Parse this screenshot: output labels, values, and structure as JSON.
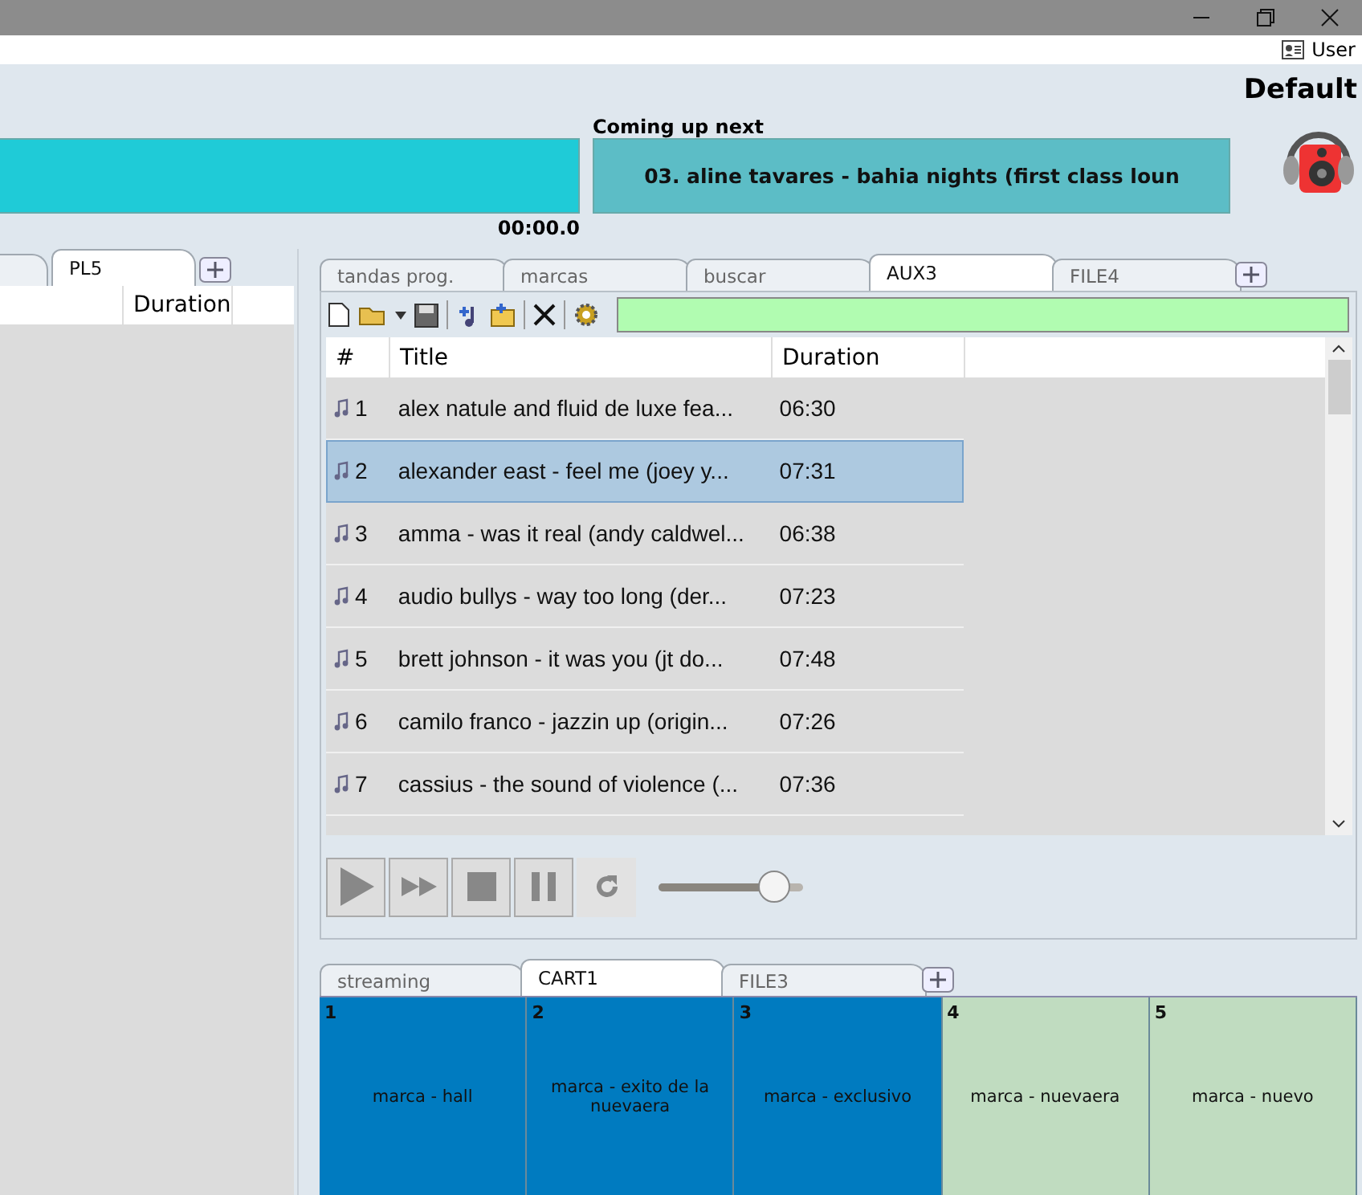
{
  "top_bar": {
    "user": "User"
  },
  "header": {
    "profile": "Default",
    "current_time": "00:00.0",
    "next_label": "Coming up next",
    "next_track": "03. aline tavares - bahia nights (first class loun"
  },
  "left_panel": {
    "tabs": [
      {
        "label": "PL5",
        "selected": true
      }
    ],
    "column_2": "Duration"
  },
  "right_panel": {
    "tabs": [
      {
        "label": "tandas prog.",
        "selected": false
      },
      {
        "label": "marcas",
        "selected": false
      },
      {
        "label": "buscar",
        "selected": false
      },
      {
        "label": "AUX3",
        "selected": true
      },
      {
        "label": "FILE4",
        "selected": false
      }
    ],
    "columns": [
      "#",
      "Title",
      "Duration"
    ],
    "rows": [
      {
        "num": "1",
        "title": "alex natule and fluid de luxe fea...",
        "duration": "06:30",
        "selected": false
      },
      {
        "num": "2",
        "title": "alexander east - feel me (joey y...",
        "duration": "07:31",
        "selected": true
      },
      {
        "num": "3",
        "title": "amma - was it real (andy caldwel...",
        "duration": "06:38",
        "selected": false
      },
      {
        "num": "4",
        "title": "audio bullys - way too long (der...",
        "duration": "07:23",
        "selected": false
      },
      {
        "num": "5",
        "title": "brett johnson - it was you (jt do...",
        "duration": "07:48",
        "selected": false
      },
      {
        "num": "6",
        "title": "camilo franco - jazzin up (origin...",
        "duration": "07:26",
        "selected": false
      },
      {
        "num": "7",
        "title": "cassius - the sound of violence (...",
        "duration": "07:36",
        "selected": false
      }
    ],
    "volume": {
      "level": 0.8
    }
  },
  "cart_panel": {
    "tabs": [
      {
        "label": "streaming",
        "selected": false
      },
      {
        "label": "CART1",
        "selected": true
      },
      {
        "label": "FILE3",
        "selected": false
      }
    ],
    "carts": [
      {
        "num": "1",
        "label": "marca - hall",
        "color": "#007bc0"
      },
      {
        "num": "2",
        "label": "marca - exito de la nuevaera",
        "color": "#007bc0"
      },
      {
        "num": "3",
        "label": "marca - exclusivo",
        "color": "#007bc0"
      },
      {
        "num": "4",
        "label": "marca - nuevaera",
        "color": "#c0dcc0"
      },
      {
        "num": "5",
        "label": "marca - nuevo",
        "color": "#c0dcc0"
      }
    ]
  }
}
